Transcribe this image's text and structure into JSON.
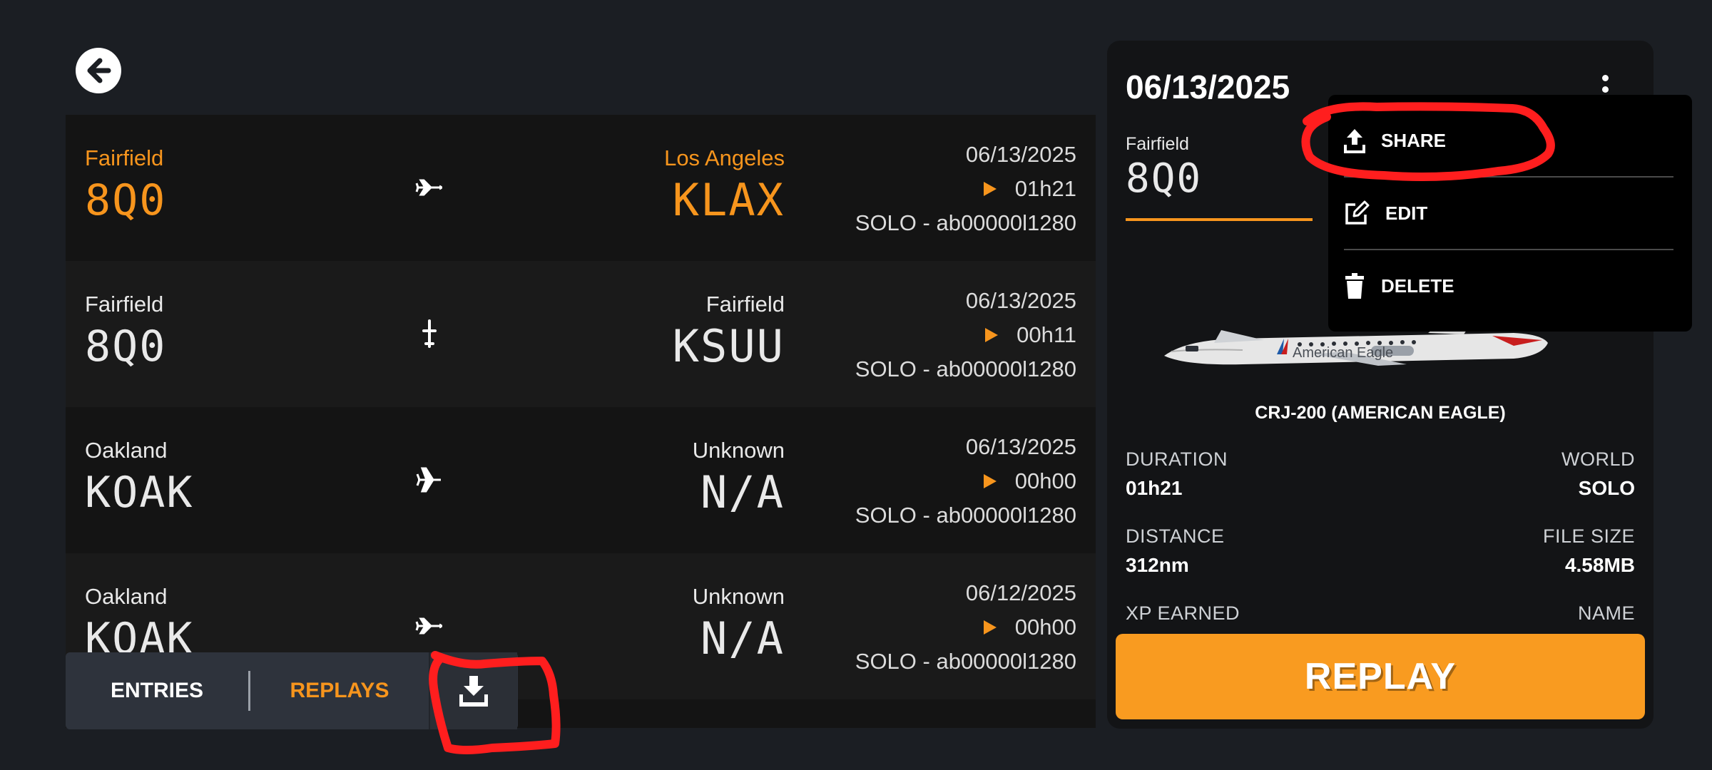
{
  "flights": [
    {
      "from_city": "Fairfield",
      "from_code": "8Q0",
      "to_city": "Los Angeles",
      "to_code": "KLAX",
      "date": "06/13/2025",
      "duration": "01h21",
      "world": "SOLO - ab00000l1280",
      "icon": "airliner-icon",
      "highlight": true
    },
    {
      "from_city": "Fairfield",
      "from_code": "8Q0",
      "to_city": "Fairfield",
      "to_code": "KSUU",
      "date": "06/13/2025",
      "duration": "00h11",
      "world": "SOLO - ab00000l1280",
      "icon": "small-plane-icon",
      "highlight": false
    },
    {
      "from_city": "Oakland",
      "from_code": "KOAK",
      "to_city": "Unknown",
      "to_code": "N/A",
      "date": "06/13/2025",
      "duration": "00h00",
      "world": "SOLO - ab00000l1280",
      "icon": "airplane-icon",
      "highlight": false
    },
    {
      "from_city": "Oakland",
      "from_code": "KOAK",
      "to_city": "Unknown",
      "to_code": "N/A",
      "date": "06/12/2025",
      "duration": "00h00",
      "world": "SOLO - ab00000l1280",
      "icon": "airliner-icon",
      "highlight": false
    }
  ],
  "tabs": {
    "entries": "ENTRIES",
    "replays": "REPLAYS"
  },
  "detail": {
    "date": "06/13/2025",
    "from_city": "Fairfield",
    "from_code": "8Q0",
    "aircraft": "CRJ-200 (AMERICAN EAGLE)",
    "livery_text": "American Eagle",
    "duration_label": "DURATION",
    "duration": "01h21",
    "world_label": "WORLD",
    "world": "SOLO",
    "distance_label": "DISTANCE",
    "distance": "312nm",
    "filesize_label": "FILE SIZE",
    "filesize": "4.58MB",
    "xp_label": "XP EARNED",
    "name_label": "NAME",
    "replay_label": "REPLAY"
  },
  "menu": {
    "share": "SHARE",
    "edit": "EDIT",
    "delete": "DELETE"
  },
  "colors": {
    "accent": "#f7951d",
    "background": "#1b1e23",
    "annotation": "#ff1e1e"
  }
}
